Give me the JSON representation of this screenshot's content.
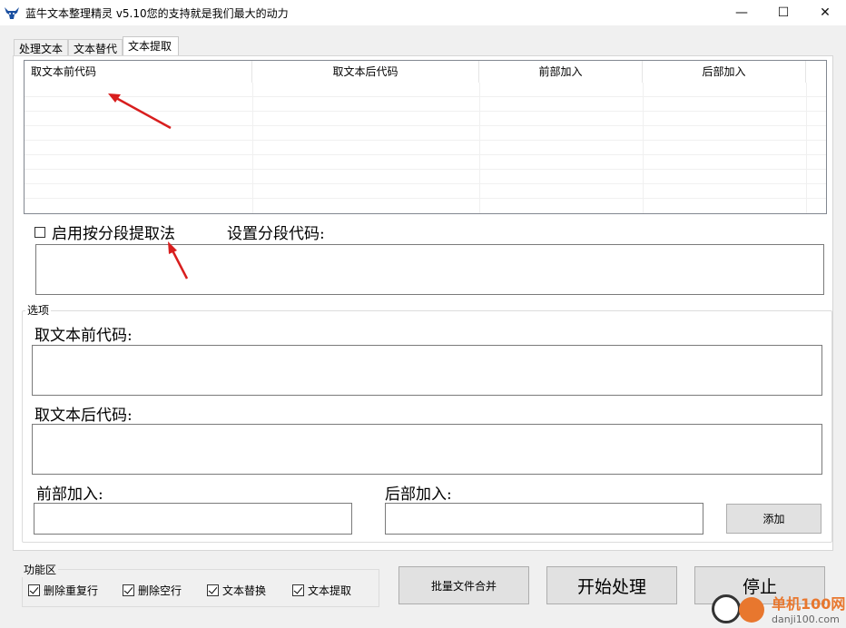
{
  "window": {
    "title": "蓝牛文本整理精灵 v5.10您的支持就是我们最大的动力",
    "minimize": "—",
    "maximize": "☐",
    "close": "✕"
  },
  "tabs": [
    {
      "label": "处理文本"
    },
    {
      "label": "文本替代"
    },
    {
      "label": "文本提取"
    }
  ],
  "grid": {
    "columns": [
      "取文本前代码",
      "取文本后代码",
      "前部加入",
      "后部加入"
    ]
  },
  "segment": {
    "checkbox_label": "启用按分段提取法",
    "code_label": "设置分段代码:"
  },
  "options": {
    "group_title": "选项",
    "prefix_label": "取文本前代码:",
    "suffix_label": "取文本后代码:",
    "front_label": "前部加入:",
    "back_label": "后部加入:",
    "add_button": "添加"
  },
  "functions": {
    "group_title": "功能区",
    "checks": [
      "删除重复行",
      "删除空行",
      "文本替换",
      "文本提取"
    ]
  },
  "buttons": {
    "merge": "批量文件合并",
    "start": "开始处理",
    "stop": "停止"
  },
  "watermark": {
    "name": "单机100网",
    "url": "danji100.com"
  }
}
